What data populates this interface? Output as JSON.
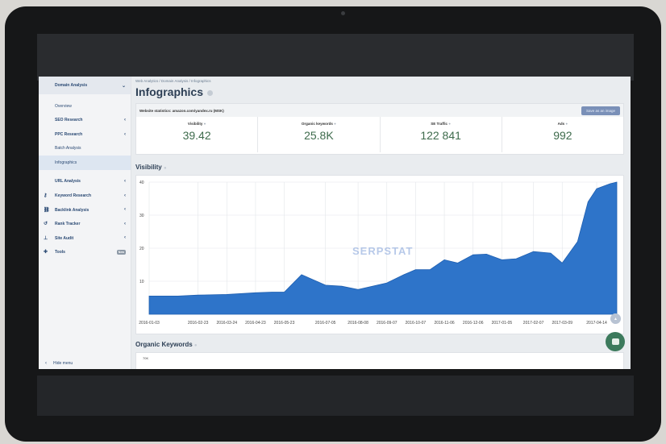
{
  "sidebar": {
    "header": "Domain Analysis",
    "items": [
      {
        "label": "Overview",
        "chevron": "",
        "icon": ""
      },
      {
        "label": "SEO Research",
        "chevron": "‹",
        "icon": ""
      },
      {
        "label": "PPC Research",
        "chevron": "‹",
        "icon": ""
      },
      {
        "label": "Batch Analysis",
        "chevron": "",
        "icon": ""
      },
      {
        "label": "Infographics",
        "chevron": "",
        "icon": ""
      }
    ],
    "tools": [
      {
        "label": "URL Analysis",
        "chevron": "‹",
        "icon": ""
      },
      {
        "label": "Keyword Research",
        "chevron": "‹",
        "icon": "key-icon"
      },
      {
        "label": "Backlink Analysis",
        "chevron": "‹",
        "icon": "link-icon"
      },
      {
        "label": "Rank Tracker",
        "chevron": "‹",
        "icon": "history-icon"
      },
      {
        "label": "Site Audit",
        "chevron": "‹",
        "icon": "sitemap-icon"
      },
      {
        "label": "Tools",
        "badge": "New",
        "icon": "gear-icon"
      }
    ],
    "hide_menu": "Hide menu"
  },
  "breadcrumb": "Web Analytics / Domain Analysis / Infographics",
  "page_title": "Infographics",
  "stats": {
    "website_label": "Website statistics: amazon.com/yandex.ru (MSK)",
    "save_button": "Save as an image",
    "items": [
      {
        "label": "Visibility",
        "value": "39.42"
      },
      {
        "label": "Organic keywords",
        "value": "25.8K"
      },
      {
        "label": "SE Traffic",
        "value": "122 841"
      },
      {
        "label": "Ads",
        "value": "992"
      }
    ]
  },
  "visibility_title": "Visibility",
  "organic_title": "Organic Keywords",
  "organic_first_tick": "70K",
  "watermark": "SERPSTAT",
  "colors": {
    "area": "#2e74c9",
    "value_green": "#3e6b4c",
    "sidebar_text": "#2b4a74"
  },
  "chart_data": {
    "type": "area",
    "title": "Visibility",
    "xlabel": "",
    "ylabel": "",
    "ylim": [
      0,
      40
    ],
    "yticks": [
      10,
      20,
      30,
      40
    ],
    "grid": true,
    "x_tick_labels": [
      "2016-01-03",
      "2016-02-23",
      "2016-03-24",
      "2016-04-23",
      "2016-05-23",
      "2016-07-05",
      "2016-08-08",
      "2016-09-07",
      "2016-10-07",
      "2016-11-06",
      "2016-12-06",
      "2017-01-05",
      "2017-02-07",
      "2017-03-09",
      "2017-04-14"
    ],
    "series": [
      {
        "x": [
          "2016-01-03",
          "2016-02-02",
          "2016-02-23",
          "2016-03-24",
          "2016-04-23",
          "2016-05-10",
          "2016-05-23",
          "2016-06-10",
          "2016-07-05",
          "2016-07-22",
          "2016-08-08",
          "2016-09-07",
          "2016-09-25",
          "2016-10-07",
          "2016-10-22",
          "2016-11-06",
          "2016-11-20",
          "2016-12-06",
          "2016-12-20",
          "2017-01-05",
          "2017-01-20",
          "2017-02-07",
          "2017-02-25",
          "2017-03-09",
          "2017-03-25",
          "2017-04-05",
          "2017-04-14",
          "2017-04-28",
          "2017-05-05"
        ],
        "values": [
          5.5,
          5.5,
          5.8,
          6,
          6.5,
          6.7,
          6.7,
          12,
          8.8,
          8.5,
          7.5,
          9.5,
          12,
          13.5,
          13.5,
          16.5,
          15.5,
          18,
          18.2,
          16.5,
          16.8,
          19,
          18.5,
          15.5,
          22,
          34,
          38,
          39.5,
          40
        ]
      }
    ]
  }
}
